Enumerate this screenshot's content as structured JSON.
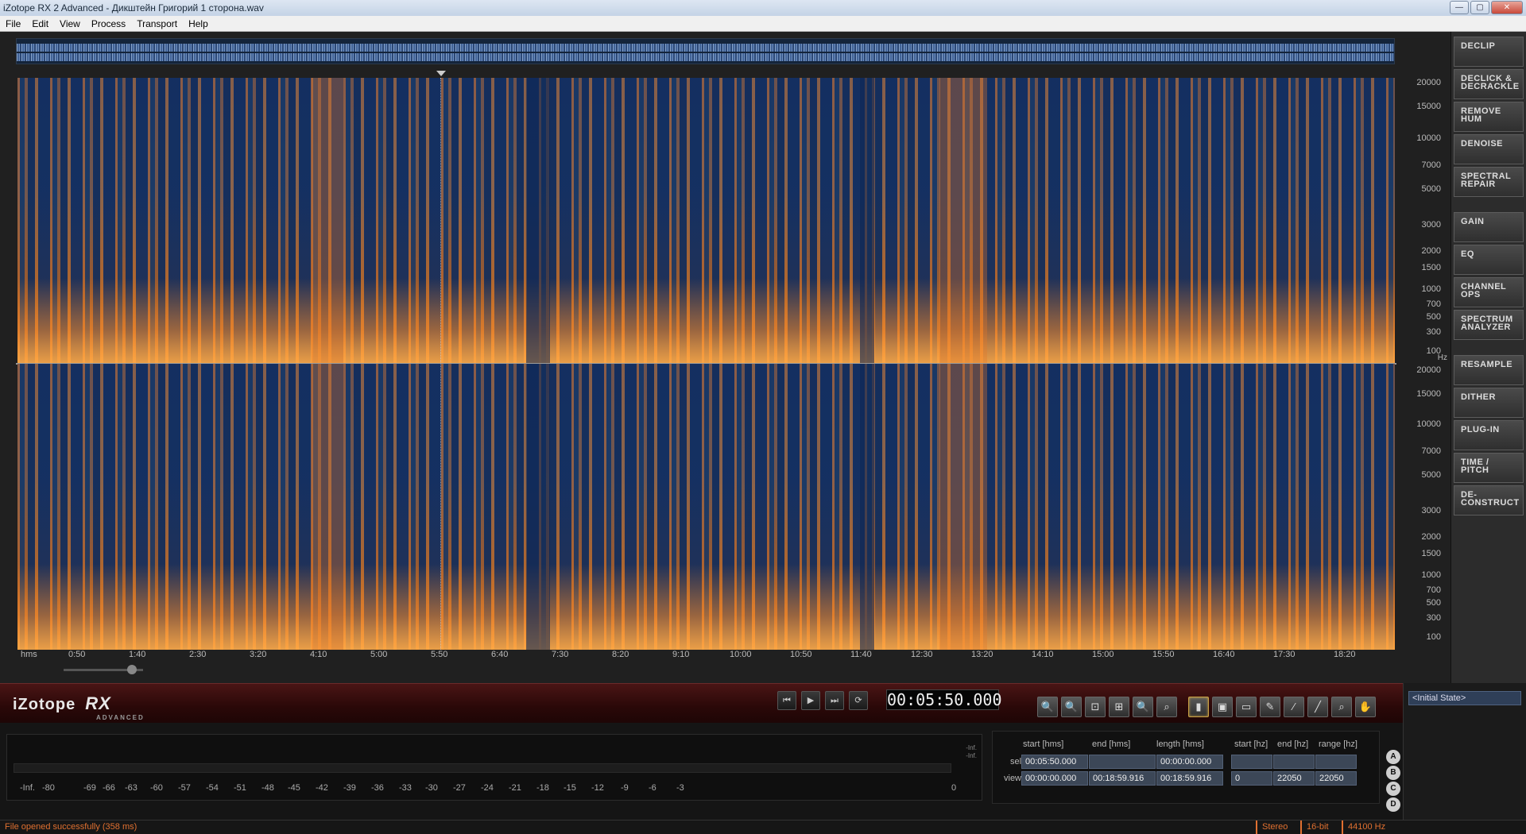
{
  "window": {
    "title": "iZotope RX 2 Advanced - Дикштейн Григорий  1 сторона.wav",
    "min_glyph": "—",
    "max_glyph": "▢",
    "close_glyph": "✕"
  },
  "menu": [
    "File",
    "Edit",
    "View",
    "Process",
    "Transport",
    "Help"
  ],
  "freq_axis": {
    "top": [
      "20000",
      "15000",
      "10000",
      "7000",
      "5000",
      "3000",
      "2000",
      "1500",
      "1000",
      "700",
      "500",
      "300",
      "100",
      "Hz"
    ],
    "bottom": [
      "20000",
      "15000",
      "10000",
      "7000",
      "5000",
      "3000",
      "2000",
      "1500",
      "1000",
      "700",
      "500",
      "300",
      "100"
    ]
  },
  "time_axis": [
    "hms",
    "0:50",
    "1:40",
    "2:30",
    "3:20",
    "4:10",
    "5:00",
    "5:50",
    "6:40",
    "7:30",
    "8:20",
    "9:10",
    "10:00",
    "10:50",
    "11:40",
    "12:30",
    "13:20",
    "14:10",
    "15:00",
    "15:50",
    "16:40",
    "17:30",
    "18:20"
  ],
  "modules": [
    {
      "line1": "DECLIP",
      "line2": ""
    },
    {
      "line1": "DECLICK &",
      "line2": "DECRACKLE"
    },
    {
      "line1": "REMOVE",
      "line2": "HUM"
    },
    {
      "line1": "DENOISE",
      "line2": ""
    },
    {
      "line1": "SPECTRAL",
      "line2": "REPAIR"
    },
    {
      "line1": "GAIN",
      "line2": ""
    },
    {
      "line1": "EQ",
      "line2": ""
    },
    {
      "line1": "CHANNEL",
      "line2": "OPS"
    },
    {
      "line1": "SPECTRUM",
      "line2": "ANALYZER"
    },
    {
      "line1": "RESAMPLE",
      "line2": ""
    },
    {
      "line1": "DITHER",
      "line2": ""
    },
    {
      "line1": "PLUG-IN",
      "line2": ""
    },
    {
      "line1": "TIME /",
      "line2": "PITCH"
    },
    {
      "line1": "DE-",
      "line2": "CONSTRUCT"
    }
  ],
  "logo": {
    "brand": "iZotope",
    "product": "RX",
    "edition": "ADVANCED"
  },
  "transport": {
    "timecode": "00:05:50.000",
    "rewind_icon": "⏮",
    "play_icon": "▶",
    "next_icon": "⏭",
    "loop_icon": "⟳"
  },
  "tools": [
    "🔍",
    "🔍",
    "⊡",
    "⊞",
    "🔍",
    "⌕",
    "▮",
    "▣",
    "▭",
    "✎",
    "⁄",
    "╱",
    "⌕",
    "✋"
  ],
  "meter": {
    "inf_top": "-Inf.",
    "inf_bot": "-Inf.",
    "scale": [
      "-Inf.",
      "-80",
      "-69",
      "-66",
      "-63",
      "-60",
      "-57",
      "-54",
      "-51",
      "-48",
      "-45",
      "-42",
      "-39",
      "-36",
      "-33",
      "-30",
      "-27",
      "-24",
      "-21",
      "-18",
      "-15",
      "-12",
      "-9",
      "-6",
      "-3",
      "0"
    ]
  },
  "selection": {
    "headers": {
      "start_hms": "start [hms]",
      "end_hms": "end [hms]",
      "length_hms": "length [hms]",
      "start_hz": "start [hz]",
      "end_hz": "end [hz]",
      "range_hz": "range [hz]"
    },
    "sel_label": "sel",
    "view_label": "view",
    "sel": {
      "start": "00:05:50.000",
      "end": "",
      "length": "00:00:00.000",
      "start_hz": "",
      "end_hz": "",
      "range_hz": ""
    },
    "view": {
      "start": "00:00:00.000",
      "end": "00:18:59.916",
      "length": "00:18:59.916",
      "start_hz": "0",
      "end_hz": "22050",
      "range_hz": "22050"
    }
  },
  "abcd": [
    "A",
    "B",
    "C",
    "D"
  ],
  "history": {
    "items": [
      "<Initial State>"
    ]
  },
  "status": {
    "message": "File opened successfully (358 ms)",
    "channels": "Stereo",
    "bit_depth": "16-bit",
    "sample_rate": "44100 Hz"
  }
}
